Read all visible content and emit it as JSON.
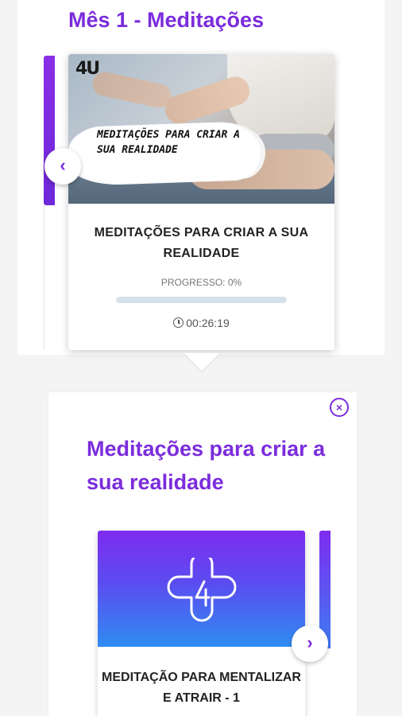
{
  "section": {
    "title": "Mês 1 - Meditações"
  },
  "course_card": {
    "logo": "4U",
    "image_label": "Meditações para criar a sua realidade",
    "title": "MEDITAÇÕES PARA CRIAR A SUA REALIDADE",
    "progress_label": "PROGRESSO: 0%",
    "progress_percent": 0,
    "duration": "00:26:19"
  },
  "carousel": {
    "prev_icon": "‹",
    "next_icon": "›"
  },
  "detail": {
    "close_icon": "×",
    "title": "Meditações para criar a sua realidade",
    "lessons": [
      {
        "title": "MEDITAÇÃO PARA MENTALIZAR E ATRAIR - 1"
      }
    ]
  },
  "colors": {
    "accent": "#7b2cdc",
    "progress_track": "#d6e1ea"
  },
  "icons": {
    "clock": "clock-icon",
    "prev": "chevron-left-icon",
    "next": "chevron-right-icon",
    "close": "close-icon",
    "lesson_logo": "cross-4-logo-icon"
  }
}
